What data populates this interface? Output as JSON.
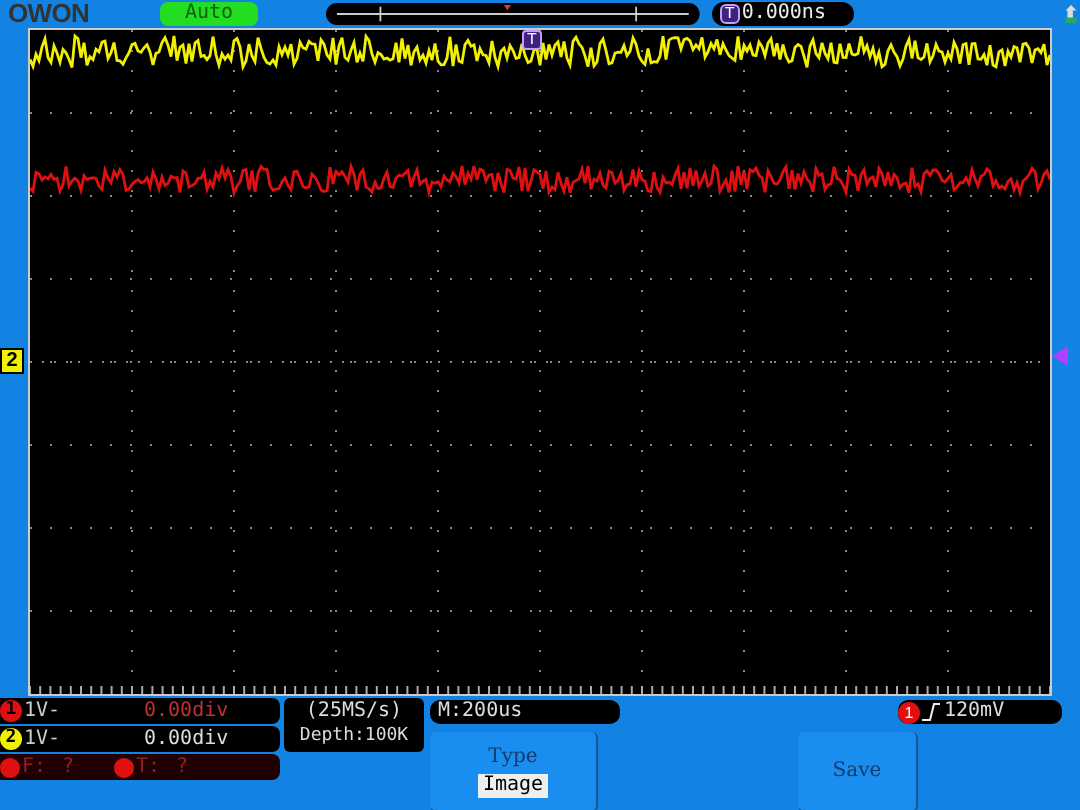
{
  "logo": "OWON",
  "mode": "Auto",
  "trigger_position": {
    "marker": "T",
    "reading": "0.000ns"
  },
  "grid_trigger_marker": "T",
  "channel_marker": "2",
  "channels": [
    {
      "number": "1",
      "color": "#e01010",
      "scale": "1V-",
      "offset": "0.00div"
    },
    {
      "number": "2",
      "color": "#f0f000",
      "scale": "1V-",
      "offset": "0.00div"
    }
  ],
  "measurements": [
    {
      "label": "F:",
      "value": "?"
    },
    {
      "label": "T:",
      "value": "?"
    }
  ],
  "sample_rate": "(25MS/s)",
  "depth": "Depth:100K",
  "timebase": "M:200us",
  "trigger": {
    "source": "1",
    "level": "120mV"
  },
  "menu": [
    {
      "label": "Type",
      "value": "Image"
    },
    {
      "label": "Save"
    }
  ]
}
